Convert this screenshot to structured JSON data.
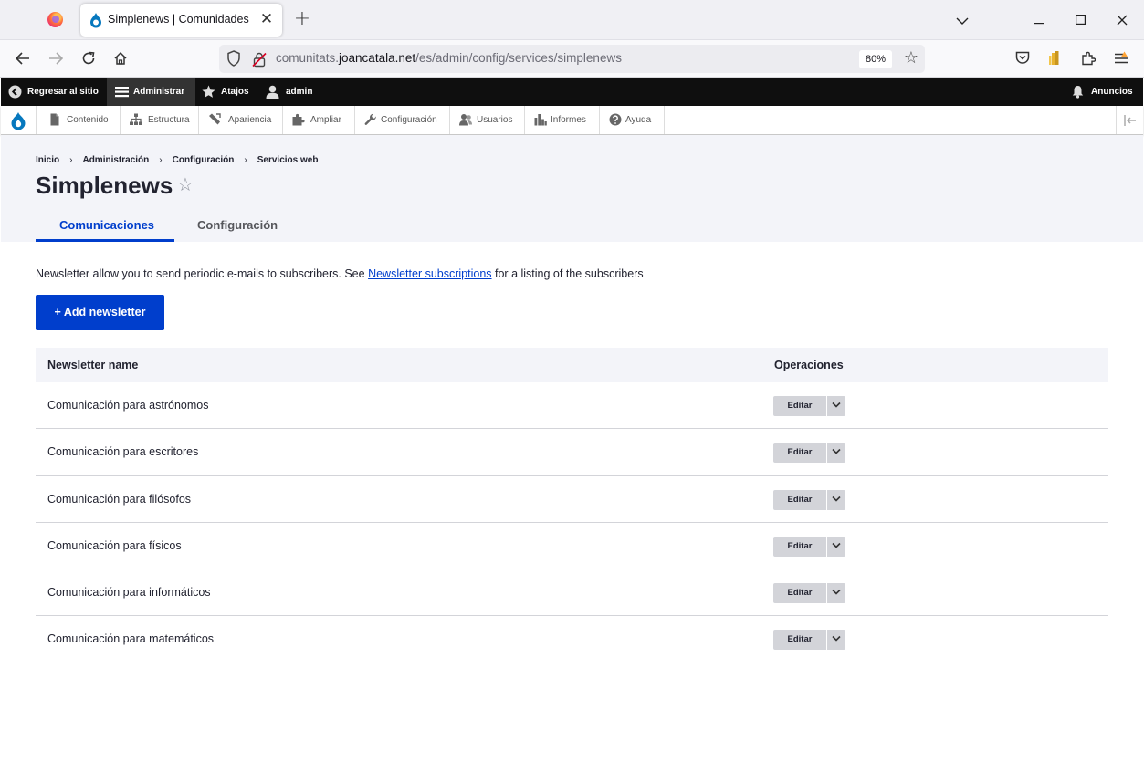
{
  "browser": {
    "tab_title": "Simplenews | Comunidades",
    "url_domain_prefix": "comunitats.",
    "url_domain_main": "joancatala.net",
    "url_path": "/es/admin/config/services/simplenews",
    "zoom": "80%"
  },
  "admin_toolbar": {
    "back_label": "Regresar al sitio",
    "manage_label": "Administrar",
    "shortcuts_label": "Atajos",
    "user_label": "admin",
    "announcements_label": "Anuncios"
  },
  "tray": {
    "items": [
      {
        "label": "Contenido",
        "icon": "file-icon"
      },
      {
        "label": "Estructura",
        "icon": "sitemap-icon"
      },
      {
        "label": "Apariencia",
        "icon": "wrench-brush-icon"
      },
      {
        "label": "Ampliar",
        "icon": "puzzle-icon"
      },
      {
        "label": "Configuración",
        "icon": "wrench-icon"
      },
      {
        "label": "Usuarios",
        "icon": "users-icon"
      },
      {
        "label": "Informes",
        "icon": "bar-chart-icon"
      },
      {
        "label": "Ayuda",
        "icon": "help-icon"
      }
    ]
  },
  "breadcrumb": [
    "Inicio",
    "Administración",
    "Configuración",
    "Servicios web"
  ],
  "page": {
    "title": "Simplenews",
    "tabs": [
      "Comunicaciones",
      "Configuración"
    ],
    "intro_before": "Newsletter allow you to send periodic e-mails to subscribers. See ",
    "intro_link": "Newsletter subscriptions",
    "intro_after": " for a listing of the subscribers",
    "add_button": "+ Add newsletter"
  },
  "table": {
    "headers": [
      "Newsletter name",
      "Operaciones"
    ],
    "rows": [
      {
        "name": "Comunicación para astrónomos",
        "operation": "Editar"
      },
      {
        "name": "Comunicación para escritores",
        "operation": "Editar"
      },
      {
        "name": "Comunicación para filósofos",
        "operation": "Editar"
      },
      {
        "name": "Comunicación para físicos",
        "operation": "Editar"
      },
      {
        "name": "Comunicación para informáticos",
        "operation": "Editar"
      },
      {
        "name": "Comunicación para matemáticos",
        "operation": "Editar"
      }
    ]
  },
  "colors": {
    "accent": "#003ecc",
    "toolbar_black": "#0f0f0f",
    "header_bg": "#f3f4f9",
    "drupal_blue": "#0678be"
  }
}
